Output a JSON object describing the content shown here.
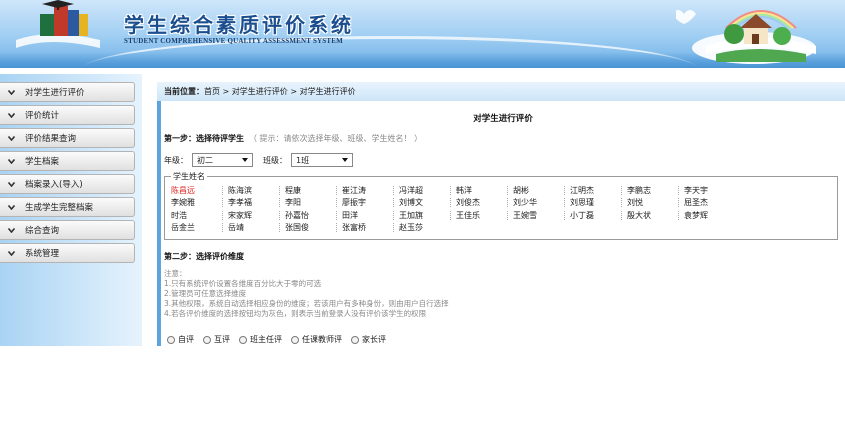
{
  "header": {
    "title_cn": "学生综合素质评价系统",
    "title_en": "STUDENT COMPREHENSIVE QUALITY ASSESSMENT SYSTEM"
  },
  "sidebar": {
    "items": [
      {
        "label": "对学生进行评价"
      },
      {
        "label": "评价统计"
      },
      {
        "label": "评价结果查询"
      },
      {
        "label": "学生档案"
      },
      {
        "label": "档案录入(导入)"
      },
      {
        "label": "生成学生完整档案"
      },
      {
        "label": "综合查询"
      },
      {
        "label": "系统管理"
      }
    ]
  },
  "breadcrumb": {
    "label": "当前位置：",
    "path": "首页 > 对学生进行评价 > 对学生进行评价"
  },
  "main": {
    "title": "对学生进行评价",
    "step1": {
      "label": "第一步：选择待评学生",
      "hint": "（ 提示：请依次选择年级、班级、学生姓名！ ）"
    },
    "grade": {
      "label": "年级：",
      "value": "初二"
    },
    "class": {
      "label": "班级：",
      "value": "1班"
    },
    "students": {
      "legend": "学生姓名",
      "selected": "陈昌远",
      "rows": [
        [
          "陈昌远",
          "陈海滨",
          "程康",
          "崔江涛",
          "冯洋超",
          "韩洋",
          "胡彬",
          "江明杰",
          "李鹏志",
          "李天宇"
        ],
        [
          "李婉雅",
          "李孝福",
          "李阳",
          "廖振宇",
          "刘博文",
          "刘俊杰",
          "刘少华",
          "刘思瑾",
          "刘悦",
          "屈圣杰"
        ],
        [
          "时浩",
          "宋家辉",
          "孙嘉怡",
          "田洋",
          "王加旗",
          "王佳乐",
          "王婉雪",
          "小丁磊",
          "殷大状",
          "袁梦辉"
        ],
        [
          "岳金兰",
          "岳靖",
          "张国俊",
          "张富桥",
          "赵玉莎"
        ]
      ]
    },
    "step2": {
      "label": "第二步：选择评价维度"
    },
    "notes": [
      "注意：",
      "1.只有系统评价设置各维度百分比大于零的可选",
      "2.管理员可任意选择维度",
      "3.其他权限，系统自动选择相应身份的维度；若该用户有多种身份，则由用户自行选择",
      "4.若各评价维度的选择按钮均为灰色，则表示当前登录人没有评价该学生的权限"
    ],
    "dimensions": [
      {
        "label": "自评"
      },
      {
        "label": "互评"
      },
      {
        "label": "班主任评"
      },
      {
        "label": "任课教师评"
      },
      {
        "label": "家长评"
      }
    ]
  },
  "colors": {
    "selected_student": "#e0221f",
    "title_blue": "#1a4e8e",
    "panel_blue": "#8fc4ec"
  }
}
